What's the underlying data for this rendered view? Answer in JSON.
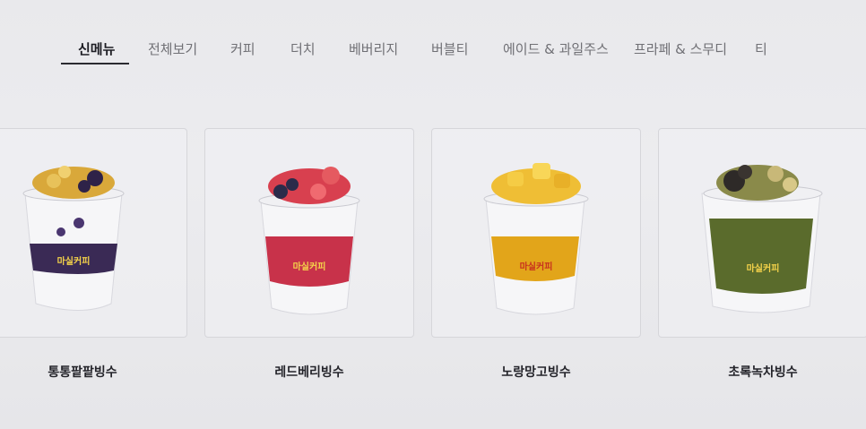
{
  "tabs": [
    {
      "label": "신메뉴",
      "active": true
    },
    {
      "label": "전체보기",
      "active": false
    },
    {
      "label": "커피",
      "active": false
    },
    {
      "label": "더치",
      "active": false
    },
    {
      "label": "베버리지",
      "active": false
    },
    {
      "label": "버블티",
      "active": false
    },
    {
      "label": "에이드 & 과일주스",
      "active": false
    },
    {
      "label": "프라페 & 스무디",
      "active": false
    },
    {
      "label": "티",
      "active": false
    }
  ],
  "products": [
    {
      "name": "통통팥팥빙수",
      "cup_brand": "마실커피",
      "band_color": "#3a2a55",
      "topping_color": "#d9a83a"
    },
    {
      "name": "레드베리빙수",
      "cup_brand": "마실커피",
      "band_color": "#c8324a",
      "topping_color": "#d8404f"
    },
    {
      "name": "노랑망고빙수",
      "cup_brand": "마실커피",
      "band_color": "#e2a51a",
      "topping_color": "#efbe35"
    },
    {
      "name": "초록녹차빙수",
      "cup_brand": "마실커피",
      "band_color": "#5a6b2c",
      "topping_color": "#8a8a4a"
    }
  ]
}
